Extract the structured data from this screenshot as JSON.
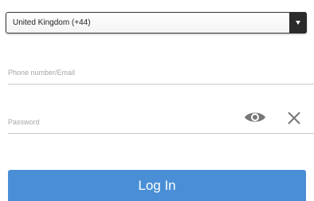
{
  "country_select": {
    "value": "United Kingdom (+44)",
    "caret_icon": "chevron-down-icon"
  },
  "phone_field": {
    "value": "",
    "placeholder": "Phone number/Email"
  },
  "password_field": {
    "value": "",
    "placeholder": "Password",
    "show_icon": "eye-icon",
    "clear_icon": "close-icon"
  },
  "login_button": {
    "label": "Log In",
    "color": "#4a8fd6"
  }
}
